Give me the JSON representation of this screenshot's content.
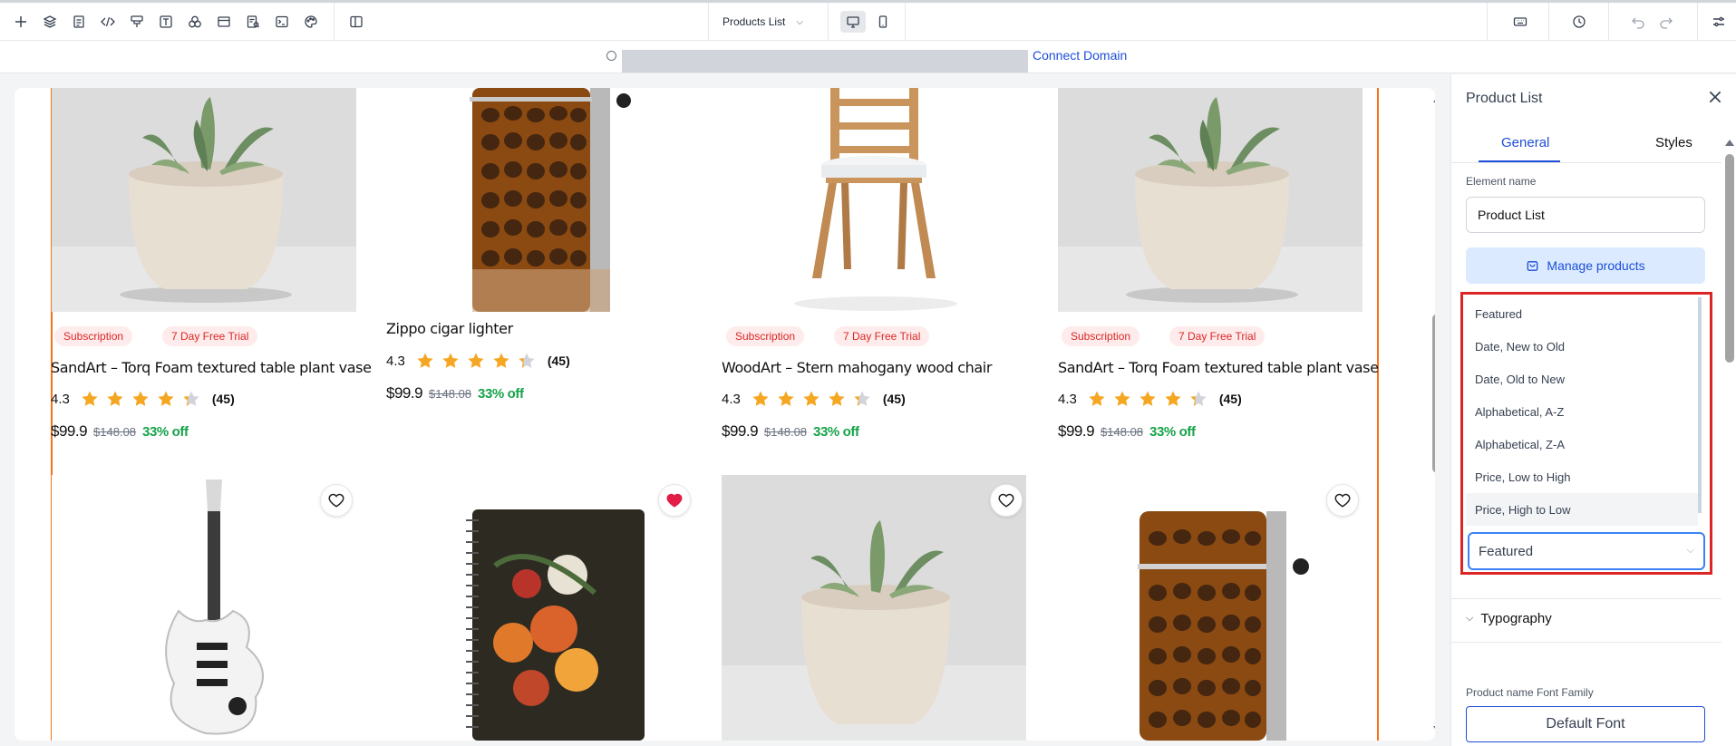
{
  "toolbar": {
    "tools": [
      "add-icon",
      "layers-icon",
      "pages-icon",
      "code-icon",
      "components-icon",
      "text-icon",
      "assets-icon",
      "section-icon",
      "forms-icon",
      "terminal-icon",
      "theme-icon",
      "sidebar-toggle-icon"
    ],
    "page_selector": "Products List",
    "devices": [
      "desktop-icon",
      "mobile-icon"
    ],
    "right_tools": [
      "keyboard-icon",
      "history-icon",
      "undo-icon",
      "redo-icon",
      "settings-icon"
    ]
  },
  "urlbar": {
    "connect_domain": "Connect Domain"
  },
  "products": [
    {
      "badges": [
        "Subscription",
        "7 Day Free Trial"
      ],
      "name": "SandArt – Torq Foam textured table plant vase",
      "rating": "4.3",
      "reviews": "(45)",
      "price": "$99.9",
      "old_price": "$148.08",
      "discount": "33% off",
      "image": "plant-pot"
    },
    {
      "badges": [],
      "name": "Zippo cigar lighter",
      "rating": "4.3",
      "reviews": "(45)",
      "price": "$99.9",
      "old_price": "$148.08",
      "discount": "33% off",
      "image": "lighter"
    },
    {
      "badges": [
        "Subscription",
        "7 Day Free Trial"
      ],
      "name": "WoodArt – Stern mahogany wood chair",
      "rating": "4.3",
      "reviews": "(45)",
      "price": "$99.9",
      "old_price": "$148.08",
      "discount": "33% off",
      "image": "chair"
    },
    {
      "badges": [
        "Subscription",
        "7 Day Free Trial"
      ],
      "name": "SandArt – Torq Foam textured table plant vase",
      "rating": "4.3",
      "reviews": "(45)",
      "price": "$99.9",
      "old_price": "$148.08",
      "discount": "33% off",
      "image": "plant-pot"
    }
  ],
  "product_row2": [
    {
      "image": "guitar",
      "favorited": false
    },
    {
      "image": "notebook",
      "favorited": true
    },
    {
      "image": "plant-pot",
      "favorited": false
    },
    {
      "image": "lighter",
      "favorited": false
    }
  ],
  "panel": {
    "title": "Product List",
    "tabs": [
      {
        "label": "General",
        "active": true
      },
      {
        "label": "Styles",
        "active": false
      }
    ],
    "element_name_label": "Element name",
    "element_name_value": "Product List",
    "manage_button": "Manage products",
    "sort_options": [
      "Featured",
      "Date, New to Old",
      "Date, Old to New",
      "Alphabetical, A-Z",
      "Alphabetical, Z-A",
      "Price, Low to High",
      "Price, High to Low"
    ],
    "hovered_option": "Price, High to Low",
    "sort_selected": "Featured",
    "typography_label": "Typography",
    "font_family_label": "Product name Font Family",
    "font_family_value": "Default Font"
  },
  "colors": {
    "accent": "#1d4ed8",
    "badge_text": "#dc2626",
    "discount": "#16a34a",
    "star": "#f5a623",
    "guide": "#f97316",
    "highlight": "#dc2626"
  }
}
